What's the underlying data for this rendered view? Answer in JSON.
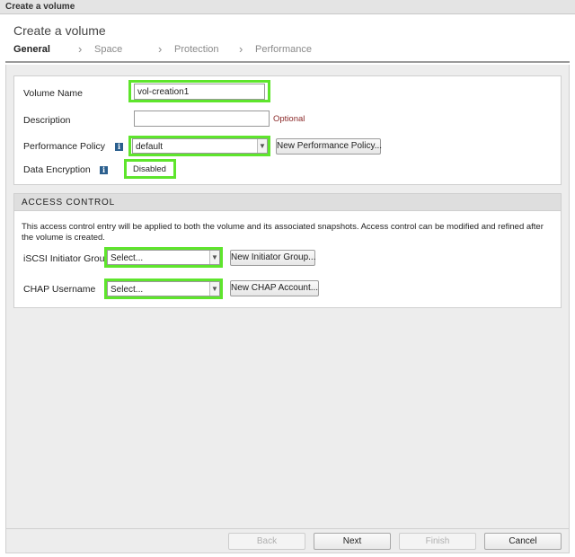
{
  "window": {
    "title": "Create a volume"
  },
  "header": {
    "title": "Create a volume",
    "steps": [
      {
        "label": "General",
        "active": true
      },
      {
        "label": "Space",
        "active": false
      },
      {
        "label": "Protection",
        "active": false
      },
      {
        "label": "Performance",
        "active": false
      }
    ]
  },
  "general": {
    "volume_name_label": "Volume Name",
    "volume_name_value": "vol-creation1",
    "description_label": "Description",
    "description_value": "",
    "optional_text": "Optional",
    "performance_policy_label": "Performance Policy",
    "performance_policy_value": "default",
    "new_performance_policy_label": "New Performance Policy...",
    "data_encryption_label": "Data Encryption",
    "data_encryption_value": "Disabled",
    "info_glyph": "i"
  },
  "access_control": {
    "header": "ACCESS CONTROL",
    "description": "This access control entry will be applied to both the volume and its associated snapshots. Access control can be modified and refined after the volume is created.",
    "iscsi_label": "iSCSI Initiator Group",
    "iscsi_value": "Select...",
    "new_initiator_group_label": "New Initiator Group...",
    "chap_label": "CHAP Username",
    "chap_value": "Select...",
    "new_chap_account_label": "New CHAP Account..."
  },
  "footer": {
    "back_label": "Back",
    "next_label": "Next",
    "finish_label": "Finish",
    "cancel_label": "Cancel"
  },
  "colors": {
    "highlight": "#5ee52c",
    "info_icon": "#2b5f8e",
    "optional_text": "#8b2a2a"
  },
  "icons": {
    "dropdown": "chevron-down-icon",
    "step_separator": "chevron-right-icon",
    "info": "info-icon"
  }
}
